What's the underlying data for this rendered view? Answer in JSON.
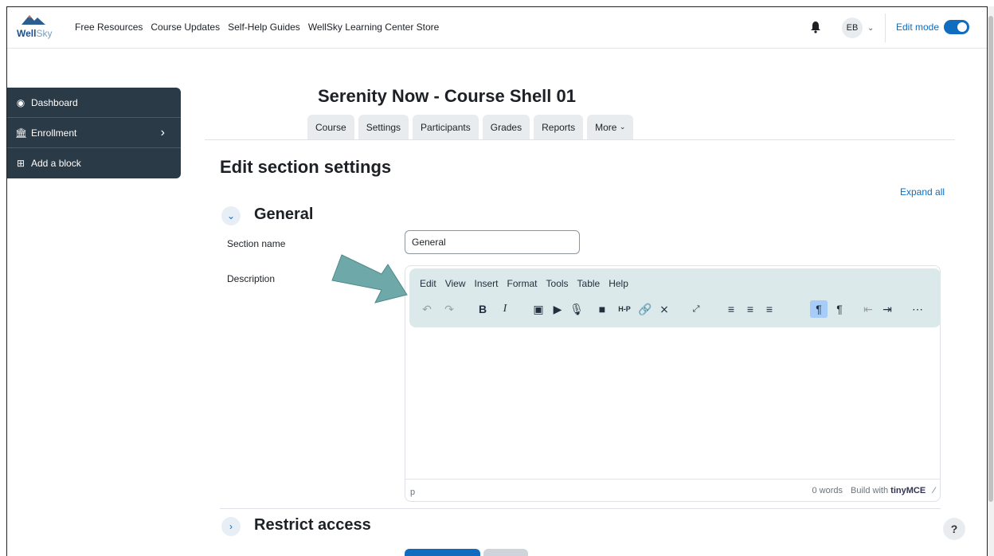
{
  "brand": {
    "name_part1": "Well",
    "name_part2": "Sky"
  },
  "topnav": {
    "links": [
      "Free Resources",
      "Course Updates",
      "Self-Help Guides",
      "WellSky Learning Center Store"
    ],
    "user_initials": "EB",
    "edit_mode_label": "Edit mode",
    "edit_mode_on": true
  },
  "sidebar": {
    "items": [
      {
        "label": "Dashboard",
        "icon": "dashboard-icon"
      },
      {
        "label": "Enrollment",
        "icon": "bank-icon"
      },
      {
        "label": "Add a block",
        "icon": "plus-square-icon"
      }
    ]
  },
  "course": {
    "title": "Serenity Now - Course Shell 01",
    "tabs": [
      "Course",
      "Settings",
      "Participants",
      "Grades",
      "Reports",
      "More"
    ]
  },
  "page": {
    "heading": "Edit section settings",
    "expand_all": "Expand all"
  },
  "general": {
    "title": "General",
    "section_name_label": "Section name",
    "section_name_value": "General",
    "description_label": "Description"
  },
  "editor": {
    "menu": [
      "Edit",
      "View",
      "Insert",
      "Format",
      "Tools",
      "Table",
      "Help"
    ],
    "toolbar_icons": [
      "undo-icon",
      "redo-icon",
      "bold-icon",
      "italic-icon",
      "image-icon",
      "media-icon",
      "record-audio-icon",
      "record-video-icon",
      "h5p-icon",
      "link-icon",
      "unlink-icon",
      "fullscreen-icon",
      "align-left-icon",
      "align-center-icon",
      "align-right-icon",
      "ltr-icon",
      "rtl-icon",
      "outdent-icon",
      "indent-icon",
      "more-icon"
    ],
    "status_path": "p",
    "word_count": "0 words",
    "build_with": "Build with",
    "tinymce_brand": "tinyMCE"
  },
  "restrict": {
    "title": "Restrict access"
  },
  "help_label": "?",
  "colors": {
    "accent": "#0f6cbf",
    "sidebar": "#2b3a47",
    "highlight": "#dbe9ea",
    "arrow": "#6fa8a8"
  }
}
